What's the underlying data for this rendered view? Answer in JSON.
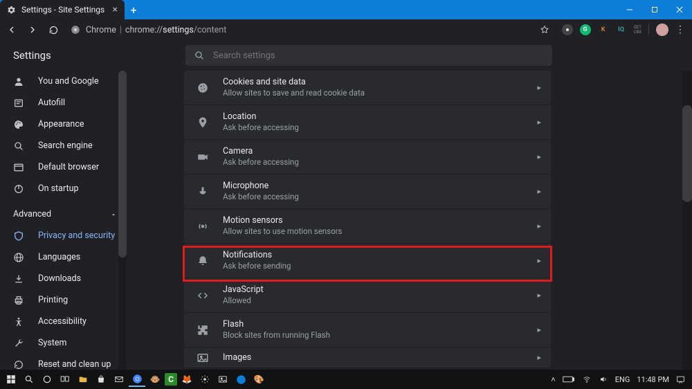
{
  "window": {
    "tab_title": "Settings - Site Settings"
  },
  "urlbar": {
    "origin": "Chrome",
    "path_prefix": "chrome://",
    "path_bold": "settings",
    "path_rest": "/content"
  },
  "extensions": {
    "k_label": "K",
    "iq_label": "IQ",
    "cbx_top": "GET",
    "cbx_bot": "CBX"
  },
  "page": {
    "title": "Settings",
    "search_placeholder": "Search settings",
    "advanced_label": "Advanced"
  },
  "sidebar": {
    "items": [
      {
        "label": "You and Google"
      },
      {
        "label": "Autofill"
      },
      {
        "label": "Appearance"
      },
      {
        "label": "Search engine"
      },
      {
        "label": "Default browser"
      },
      {
        "label": "On startup"
      }
    ],
    "advanced_items": [
      {
        "label": "Privacy and security"
      },
      {
        "label": "Languages"
      },
      {
        "label": "Downloads"
      },
      {
        "label": "Printing"
      },
      {
        "label": "Accessibility"
      },
      {
        "label": "System"
      },
      {
        "label": "Reset and clean up"
      }
    ]
  },
  "settings_rows": [
    {
      "title": "Cookies and site data",
      "subtitle": "Allow sites to save and read cookie data"
    },
    {
      "title": "Location",
      "subtitle": "Ask before accessing"
    },
    {
      "title": "Camera",
      "subtitle": "Ask before accessing"
    },
    {
      "title": "Microphone",
      "subtitle": "Ask before accessing"
    },
    {
      "title": "Motion sensors",
      "subtitle": "Allow sites to use motion sensors"
    },
    {
      "title": "Notifications",
      "subtitle": "Ask before sending"
    },
    {
      "title": "JavaScript",
      "subtitle": "Allowed"
    },
    {
      "title": "Flash",
      "subtitle": "Block sites from running Flash"
    },
    {
      "title": "Images",
      "subtitle": ""
    }
  ],
  "tray": {
    "lang": "ENG",
    "time": "11:48 PM"
  }
}
